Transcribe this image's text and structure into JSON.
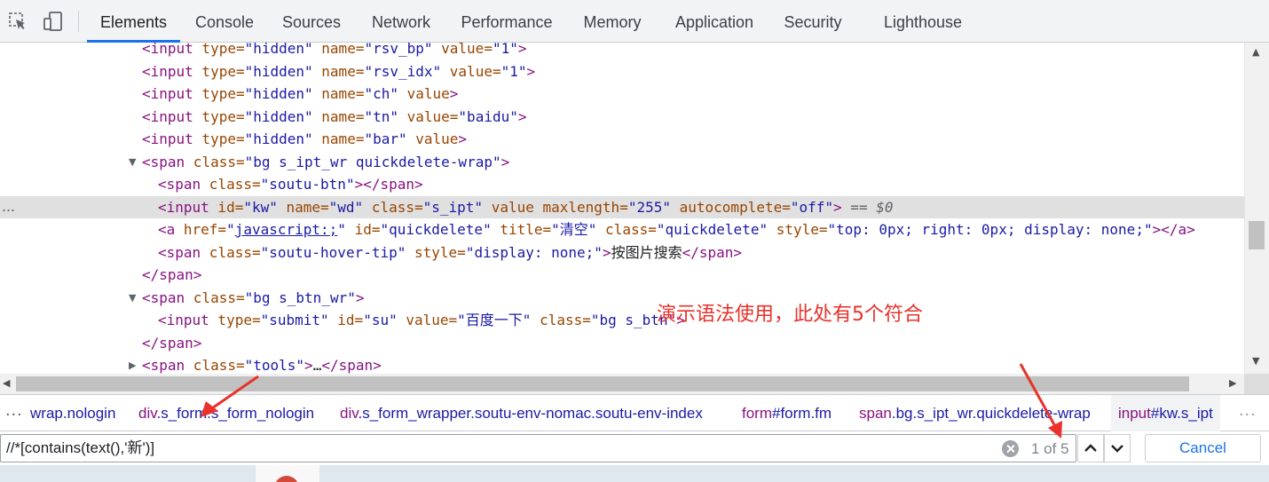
{
  "tabs": [
    {
      "label": "Elements",
      "active": true
    },
    {
      "label": "Console"
    },
    {
      "label": "Sources"
    },
    {
      "label": "Network"
    },
    {
      "label": "Performance"
    },
    {
      "label": "Memory"
    },
    {
      "label": "Application"
    },
    {
      "label": "Security"
    },
    {
      "label": "Lighthouse"
    }
  ],
  "tree": {
    "l1": {
      "t1": "<input",
      "a1": " type=",
      "v1": "\"hidden\"",
      "a2": " name=",
      "v2": "\"rsv_bp\"",
      "a3": " value=",
      "v3": "\"1\"",
      "t2": ">"
    },
    "l2": {
      "t1": "<input",
      "a1": " type=",
      "v1": "\"hidden\"",
      "a2": " name=",
      "v2": "\"rsv_idx\"",
      "a3": " value=",
      "v3": "\"1\"",
      "t2": ">"
    },
    "l3": {
      "t1": "<input",
      "a1": " type=",
      "v1": "\"hidden\"",
      "a2": " name=",
      "v2": "\"ch\"",
      "a3": " value",
      "t2": ">"
    },
    "l4": {
      "t1": "<input",
      "a1": " type=",
      "v1": "\"hidden\"",
      "a2": " name=",
      "v2": "\"tn\"",
      "a3": " value=",
      "v3": "\"baidu\"",
      "t2": ">"
    },
    "l5": {
      "t1": "<input",
      "a1": " type=",
      "v1": "\"hidden\"",
      "a2": " name=",
      "v2": "\"bar\"",
      "a3": " value",
      "t2": ">"
    },
    "l6": {
      "t1": "<span",
      "a1": " class=",
      "v1": "\"bg s_ipt_wr quickdelete-wrap\"",
      "t2": ">"
    },
    "l7": {
      "t1": "<span",
      "a1": " class=",
      "v1": "\"soutu-btn\"",
      "t2": "></span>"
    },
    "l8": {
      "t1": "<input",
      "a1": " id=",
      "v1": "\"kw\"",
      "a2": " name=",
      "v2": "\"wd\"",
      "a3": " class=",
      "v3": "\"s_ipt\"",
      "a4": " value maxlength=",
      "v4": "\"255\"",
      "a5": " autocomplete=",
      "v5": "\"off\"",
      "t2": ">",
      "marker": " == $0"
    },
    "l9": {
      "t1": "<a",
      "a1": " href=",
      "v1": "\"",
      "link": "javascript:;",
      "v1b": "\"",
      "a2": " id=",
      "v2": "\"quickdelete\"",
      "a3": " title=",
      "v3": "\"清空\"",
      "a4": " class=",
      "v4": "\"quickdelete\"",
      "a5": " style=",
      "v5": "\"top: 0px; right: 0px; display: none;\"",
      "t2": "></a>"
    },
    "l10": {
      "t1": "<span",
      "a1": " class=",
      "v1": "\"soutu-hover-tip\"",
      "a2": " style=",
      "v2": "\"display: none;\"",
      "t2": ">",
      "text": "按图片搜索",
      "t3": "</span>"
    },
    "l11": {
      "t1": "</span>"
    },
    "l12": {
      "t1": "<span",
      "a1": " class=",
      "v1": "\"bg s_btn_wr\"",
      "t2": ">"
    },
    "l13": {
      "t1": "<input",
      "a1": " type=",
      "v1": "\"submit\"",
      "a2": " id=",
      "v2": "\"su\"",
      "a3": " value=",
      "v3": "\"百度一下\"",
      "a4": " class=",
      "v4": "\"bg s_btn\"",
      "t2": ">"
    },
    "l14": {
      "t1": "</span>"
    },
    "l15": {
      "t1": "<span",
      "a1": " class=",
      "v1": "\"tools\"",
      "t2": ">",
      "text": "…",
      "t3": "</span>"
    }
  },
  "row_ellipsis": "...",
  "breadcrumbs": {
    "more_left": "...",
    "more_right": "...",
    "items": [
      {
        "el": "",
        "cls": "wrap.nologin"
      },
      {
        "el": "div",
        "cls": ".s_form.s_form_nologin"
      },
      {
        "el": "div",
        "cls": ".s_form_wrapper.soutu-env-nomac.soutu-env-index"
      },
      {
        "el": "form",
        "cls": "#form.fm"
      },
      {
        "el": "span",
        "cls": ".bg.s_ipt_wr.quickdelete-wrap"
      },
      {
        "el": "input",
        "cls": "#kw.s_ipt"
      }
    ]
  },
  "search": {
    "value": "//*[contains(text(),'新')]",
    "match_count": "1 of 5",
    "cancel_label": "Cancel"
  },
  "annotation": "演示语法使用，此处有5个符合",
  "colors": {
    "accent": "#1a73e8",
    "tag": "#881280",
    "attr_name": "#994500",
    "attr_value": "#1a1aa6",
    "annotation": "#e8322b"
  }
}
